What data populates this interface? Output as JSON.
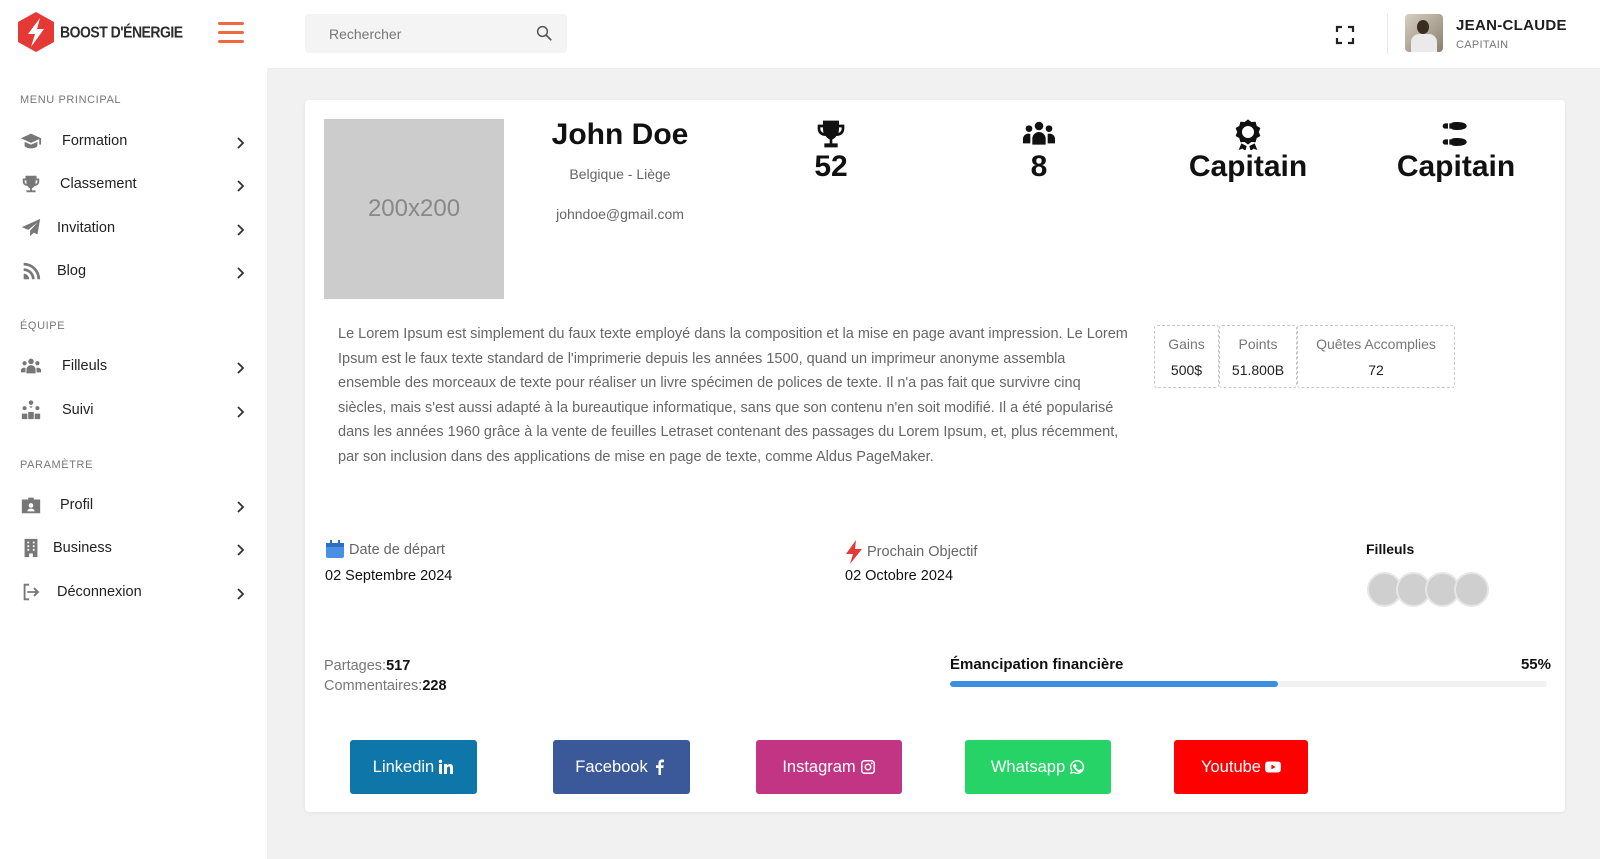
{
  "brand": {
    "name": "BOOST D'ÉNERGIE"
  },
  "search": {
    "placeholder": "Rechercher"
  },
  "user": {
    "name": "JEAN-CLAUDE",
    "role": "CAPITAIN"
  },
  "sidebar": {
    "sections": [
      {
        "title": "MENU PRINCIPAL",
        "items": [
          {
            "label": "Formation",
            "icon": "graduation-cap-icon"
          },
          {
            "label": "Classement",
            "icon": "trophy-icon"
          },
          {
            "label": "Invitation",
            "icon": "paper-plane-icon"
          },
          {
            "label": "Blog",
            "icon": "blog-icon"
          }
        ]
      },
      {
        "title": "ÉQUIPE",
        "items": [
          {
            "label": "Filleuls",
            "icon": "users-icon"
          },
          {
            "label": "Suivi",
            "icon": "people-arrows-icon"
          }
        ]
      },
      {
        "title": "PARAMÈTRE",
        "items": [
          {
            "label": "Profil",
            "icon": "id-badge-icon"
          },
          {
            "label": "Business",
            "icon": "building-icon"
          },
          {
            "label": "Déconnexion",
            "icon": "sign-out-icon"
          }
        ]
      }
    ]
  },
  "profile": {
    "image_text": "200x200",
    "name": "John Doe",
    "location": "Belgique - Liège",
    "email": "johndoe@gmail.com",
    "stats": [
      {
        "icon": "trophy-icon",
        "value": "52"
      },
      {
        "icon": "users-icon",
        "value": "8"
      },
      {
        "icon": "award-icon",
        "value": "Capitain"
      },
      {
        "icon": "shoe-prints-icon",
        "value": "Capitain"
      }
    ],
    "description": "Le Lorem Ipsum est simplement du faux texte employé dans la composition et la mise en page avant impression. Le Lorem Ipsum est le faux texte standard de l'imprimerie depuis les années 1500, quand un imprimeur anonyme assembla ensemble des morceaux de texte pour réaliser un livre spécimen de polices de texte. Il n'a pas fait que survivre cinq siècles, mais s'est aussi adapté à la bureautique informatique, sans que son contenu n'en soit modifié. Il a été popularisé dans les années 1960 grâce à la vente de feuilles Letraset contenant des passages du Lorem Ipsum, et, plus récemment, par son inclusion dans des applications de mise en page de texte, comme Aldus PageMaker.",
    "info_boxes": [
      {
        "label": "Gains",
        "value": "500$"
      },
      {
        "label": "Points",
        "value": "51.800B"
      },
      {
        "label": "Quêtes Accomplies",
        "value": "72"
      }
    ],
    "start": {
      "label": "Date de départ",
      "value": "02 Septembre 2024"
    },
    "objective": {
      "label": "Prochain Objectif",
      "value": "02 Octobre 2024"
    },
    "filleuls": {
      "title": "Filleuls",
      "avatars": [
        "",
        "",
        "",
        ""
      ]
    },
    "shares": {
      "label": "Partages:",
      "value": "517"
    },
    "comments": {
      "label": "Commentaires:",
      "value": "228"
    },
    "progress": {
      "label": "Émancipation financière",
      "percent_text": "55%",
      "fraction": 0.55
    },
    "social": [
      {
        "label": "Linkedin",
        "color": "#0e76a8",
        "icon": "linkedin-icon"
      },
      {
        "label": "Facebook",
        "color": "#3b5998",
        "icon": "facebook-icon"
      },
      {
        "label": "Instagram",
        "color": "#c13584",
        "icon": "instagram-icon"
      },
      {
        "label": "Whatsapp",
        "color": "#25d366",
        "icon": "whatsapp-icon"
      },
      {
        "label": "Youtube",
        "color": "#ff0000",
        "icon": "youtube-icon"
      }
    ]
  },
  "colors": {
    "accent": "#ee6a3d",
    "progress": "#3b8fe0",
    "brand_red": "#e53935"
  }
}
